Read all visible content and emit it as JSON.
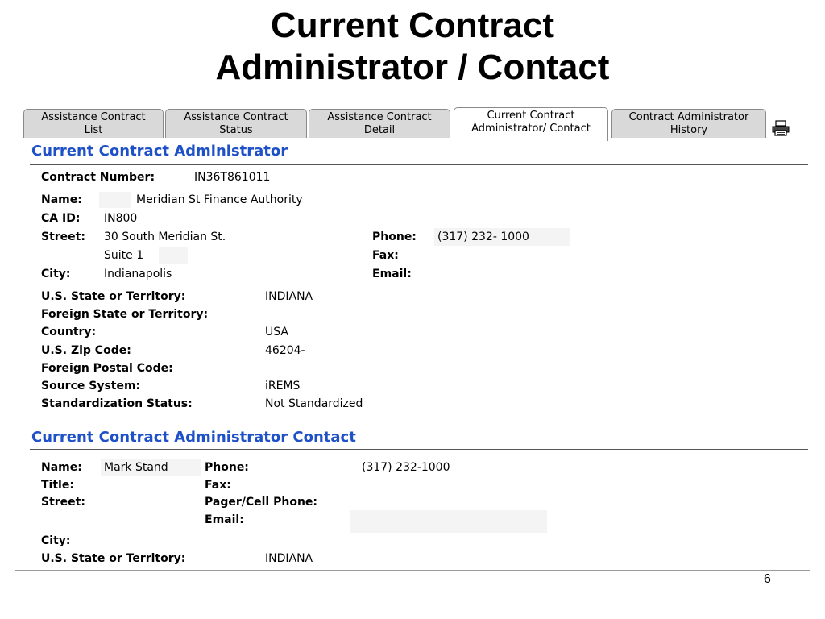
{
  "slide": {
    "title_line1": "Current Contract",
    "title_line2": "Administrator / Contact",
    "page_number": "6"
  },
  "tabs": [
    {
      "line1": "Assistance Contract",
      "line2": "List"
    },
    {
      "line1": "Assistance Contract",
      "line2": "Status"
    },
    {
      "line1": "Assistance Contract",
      "line2": "Detail"
    },
    {
      "line1": "Current Contract",
      "line2": "Administrator/ Contact"
    },
    {
      "line1": "Contract Administrator",
      "line2": "History"
    }
  ],
  "administrator": {
    "section_title": "Current Contract Administrator",
    "contract_number_label": "Contract Number:",
    "contract_number": "IN36T861011",
    "name_label": "Name:",
    "name": "Meridian St  Finance Authority",
    "ca_id_label": "CA ID:",
    "ca_id": "IN800",
    "street_label": "Street:",
    "street_line1": "30 South Meridian St.",
    "street_line2": "Suite 1",
    "city_label": "City:",
    "city": "Indianapolis",
    "phone_label": "Phone:",
    "phone": "(317) 232- 1000",
    "fax_label": "Fax:",
    "email_label": "Email:",
    "us_state_label": "U.S. State or Territory:",
    "us_state": "INDIANA",
    "foreign_state_label": "Foreign State or Territory:",
    "country_label": "Country:",
    "country": "USA",
    "zip_label": "U.S. Zip Code:",
    "zip": "46204-",
    "foreign_postal_label": "Foreign Postal Code:",
    "source_system_label": "Source System:",
    "source_system": "iREMS",
    "standardization_label": "Standardization Status:",
    "standardization": "Not Standardized"
  },
  "contact": {
    "section_title": "Current Contract Administrator Contact",
    "name_label": "Name:",
    "name": "Mark Stand",
    "title_label": "Title:",
    "street_label": "Street:",
    "city_label": "City:",
    "us_state_label": "U.S. State or Territory:",
    "us_state": "INDIANA",
    "phone_label": "Phone:",
    "phone": "(317) 232-1000",
    "fax_label": "Fax:",
    "pager_label": "Pager/Cell Phone:",
    "email_label": "Email:"
  }
}
